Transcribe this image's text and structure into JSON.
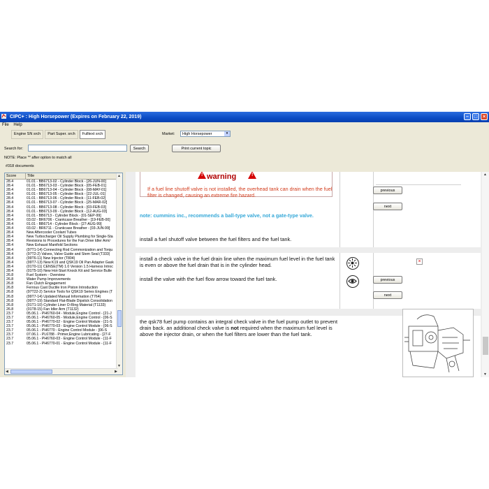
{
  "window": {
    "title": "CIPC+ : High Horsepower (Expires on February 22, 2019)"
  },
  "menu": [
    "File",
    "Help"
  ],
  "tabs": [
    "Engine SN srch",
    "Part Super. srch",
    "Fulltext srch"
  ],
  "market": {
    "label": "Market:",
    "value": "High Horsepower"
  },
  "search": {
    "label": "Search for:",
    "value": "",
    "button": "Search"
  },
  "print_button": "Print current topic",
  "note": "NOTE: Place '*' after option to match all",
  "doc_count": "#318 documents",
  "list": {
    "headers": [
      "Score",
      "Title"
    ],
    "rows": [
      {
        "score": "28.4",
        "title": "01.01 - BB6713-02 - Cylinder Block - [26-JUN-00]"
      },
      {
        "score": "28.4",
        "title": "01.01 - BB6713-03 - Cylinder Block - [05-FEB-01]"
      },
      {
        "score": "28.4",
        "title": "01.01 - BB6713-04 - Cylinder Block - [08-MAY-01]"
      },
      {
        "score": "28.4",
        "title": "01.01 - BB6713-05 - Cylinder Block - [22-JUL-01]"
      },
      {
        "score": "28.4",
        "title": "01.01 - BB6713-06 - Cylinder Block - [11-FEB-02]"
      },
      {
        "score": "28.4",
        "title": "01.01 - BB6713-07 - Cylinder Block - [25-MAR-02]"
      },
      {
        "score": "28.4",
        "title": "01.01 - BB6713-08 - Cylinder Block - [03-FEB-03]"
      },
      {
        "score": "28.4",
        "title": "01.01 - BB6713-09 - Cylinder Block - [12-AUG-03]"
      },
      {
        "score": "28.4",
        "title": "01.01 - BB6713 - Cylinder Block - [01-SEP-99]"
      },
      {
        "score": "28.4",
        "title": "03.02 - BR6706 - Crankcase Breather - [19-FEB-00]"
      },
      {
        "score": "28.4",
        "title": "01.01 - BB6714 - Cylinder Block - [27-AUG-99]"
      },
      {
        "score": "28.4",
        "title": "03.02 - BR6711 - Crankcase Breather - [03-JUN-99]"
      },
      {
        "score": "28.4",
        "title": "New Aftercooler Coolant Tubes"
      },
      {
        "score": "28.4",
        "title": "New Turbocharger Oil Supply Plumbing for Single-Sta"
      },
      {
        "score": "28.4",
        "title": "Revisions to Procedures for the Fan Drive Idler Arm/"
      },
      {
        "score": "28.4",
        "title": "New Exhaust Manifold Sections"
      },
      {
        "score": "28.4",
        "title": "(97T1-14) Connecting Rod Commonization and Torqu"
      },
      {
        "score": "28.4",
        "title": "(97T2-2) Valves, Valve Guide and Stem Seal (T333)"
      },
      {
        "score": "28.4",
        "title": "(99T6-11) New Injector (T804)"
      },
      {
        "score": "28.4",
        "title": "(99T7-13) New K19 and QSK19 Oil Pan Adapter Gask"
      },
      {
        "score": "28.4",
        "title": "(01T0-11) CENSE(TM) 1.0 Version 1.5 Harness Introc"
      },
      {
        "score": "28.4",
        "title": "(01T5-10) New Hot-Start Knock Kit and Service Bulle"
      },
      {
        "score": "26.8",
        "title": "Fuel System - Overview"
      },
      {
        "score": "26.8",
        "title": "Water Pump Improvements"
      },
      {
        "score": "26.8",
        "title": "Fan Clutch Engagement"
      },
      {
        "score": "26.8",
        "title": "Ferrous Cast Ductile Iron Piston Introduction"
      },
      {
        "score": "26.8",
        "title": "(97T22-2) Service Tools for QSK19 Series Engines (T"
      },
      {
        "score": "26.8",
        "title": "(99T7-14) Updated Manual Information (T764)"
      },
      {
        "score": "26.8",
        "title": "(00T7-19) Standard Flat-Blade Dipstick Consolidation"
      },
      {
        "score": "26.8",
        "title": "(01T1-10) Cylinder Liner O-Ring Material (T1133)"
      },
      {
        "score": "26.8",
        "title": "(01T8-15) Fan Idler Arm (T1132)"
      },
      {
        "score": "23.7",
        "title": "05.06.1 - PH6760-04 - Module,Engine Control - [21-J"
      },
      {
        "score": "23.7",
        "title": "05.06.1 - PH6760-05 - Module,Engine Control - [06-S"
      },
      {
        "score": "23.7",
        "title": "05.06.1 - PH6770-02 - Engine Control Module - [21-S"
      },
      {
        "score": "23.7",
        "title": "05.06.1 - PH6770-03 - Engine Control Module - [06-S"
      },
      {
        "score": "23.7",
        "title": "05.06.1 - PH6770 - Engine Control Module - [06-S"
      },
      {
        "score": "23.7",
        "title": "07.06.1 - PL6788 - Primer,Engine Lubricating - [27-F"
      },
      {
        "score": "23.7",
        "title": "05.06.1 - PH6760-03 - Engine Control Module - [11-F"
      },
      {
        "score": "23.7",
        "title": "05.06.1 - PH6770-01 - Engine Control Module - [11-F"
      }
    ]
  },
  "content": {
    "warning_title": "warning",
    "warning_text": "If a fuel line shutoff valve is not installed, the overhead tank can drain when the fuel filter is changed, causing an extreme fire hazard.",
    "note_text": "note: cummins inc., recommends a ball-type valve, not a gate-type valve.",
    "step1": "install a fuel shutoff valve between the fuel filters and the fuel tank.",
    "step2": "install a check valve in the fuel drain line when the maximum fuel level in the fuel tank is even or above the fuel drain that is in the cylinder head.",
    "step2b": "install the valve with the fuel flow arrow toward the fuel tank.",
    "step3a": "the qsk78 fuel pump contains an integral check valve in the fuel pump outlet to prevent drain back. an additional check valve is",
    "step3_bold": "not",
    "step3b": "required when the maximum fuel level is above the injector drain, or when the fuel filters are lower than the fuel tank.",
    "previous_label": "previous",
    "next_label": "next"
  },
  "colors": {
    "warning": "#d23a1a",
    "note": "#35a8d8",
    "titlebar": "#0a4bc4"
  }
}
